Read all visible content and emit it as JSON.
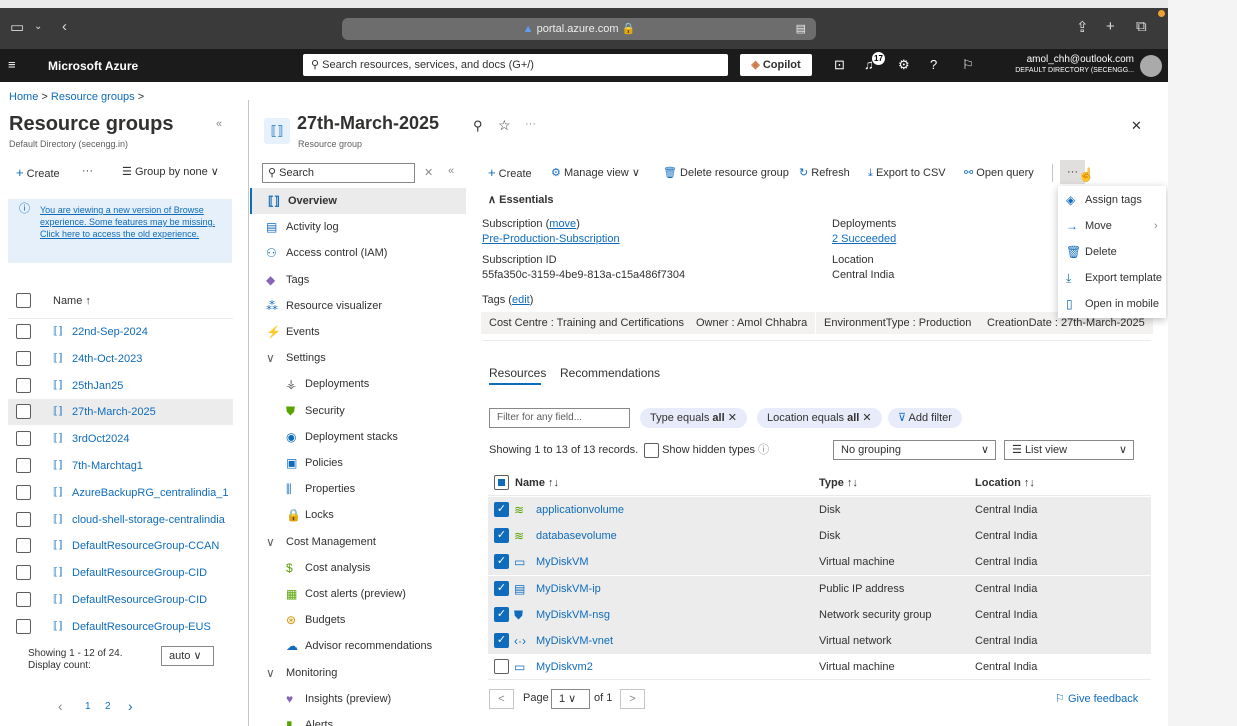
{
  "browser": {
    "url": "portal.azure.com",
    "lock": "🔒"
  },
  "azure": {
    "brand": "Microsoft Azure",
    "search_placeholder": "Search resources, services, and docs (G+/)",
    "copilot": "Copilot",
    "notif_count": "17",
    "user_email": "amol_chh@outlook.com",
    "user_dir": "DEFAULT DIRECTORY (SECENGG..."
  },
  "breadcrumb": {
    "home": "Home",
    "sep1": ">",
    "rg": "Resource groups",
    "sep2": ">"
  },
  "left": {
    "title": "Resource groups",
    "subtitle": "Default Directory (secengg.in)",
    "collapse": "«",
    "create": "Create",
    "more": "···",
    "group_by": "Group by none",
    "banner": "You are viewing a new version of Browse experience. Some features may be missing. Click here to access the old experience.",
    "col_name": "Name ↑",
    "items": [
      "22nd-Sep-2024",
      "24th-Oct-2023",
      "25thJan25",
      "27th-March-2025",
      "3rdOct2024",
      "7th-Marchtag1",
      "AzureBackupRG_centralindia_1",
      "cloud-shell-storage-centralindia",
      "DefaultResourceGroup-CCAN",
      "DefaultResourceGroup-CID",
      "DefaultResourceGroup-CID",
      "DefaultResourceGroup-EUS"
    ],
    "showing": "Showing 1 - 12 of 24.",
    "display_count": "Display count:",
    "count_value": "auto",
    "pages": [
      "1",
      "2"
    ]
  },
  "rg": {
    "title": "27th-March-2025",
    "subtitle": "Resource group",
    "pin": "⚲",
    "star": "☆",
    "more": "···",
    "close": "✕"
  },
  "nav": {
    "search_placeholder": "Search",
    "items": [
      "Overview",
      "Activity log",
      "Access control (IAM)",
      "Tags",
      "Resource visualizer",
      "Events",
      "Settings",
      "Deployments",
      "Security",
      "Deployment stacks",
      "Policies",
      "Properties",
      "Locks",
      "Cost Management",
      "Cost analysis",
      "Cost alerts (preview)",
      "Budgets",
      "Advisor recommendations",
      "Monitoring",
      "Insights (preview)",
      "Alerts"
    ]
  },
  "toolbar": {
    "create": "Create",
    "manage_view": "Manage view",
    "delete": "Delete resource group",
    "refresh": "Refresh",
    "export_csv": "Export to CSV",
    "open_query": "Open query",
    "more": "···"
  },
  "essentials": {
    "header": "Essentials",
    "subscription_label": "Subscription",
    "move_link": "move",
    "subscription_value": "Pre-Production-Subscription",
    "subscription_id_label": "Subscription ID",
    "subscription_id": "55fa350c-3159-4be9-813a-c15a486f7304",
    "deployments_label": "Deployments",
    "deployments_value": "2 Succeeded",
    "location_label": "Location",
    "location_value": "Central India",
    "tags_label": "Tags",
    "edit_link": "edit",
    "tags": [
      "Cost Centre : Training and Certifications",
      "Owner : Amol Chhabra",
      "EnvironmentType : Production",
      "CreationDate : 27th-March-2025"
    ]
  },
  "context_menu": [
    "Assign tags",
    "Move",
    "Delete",
    "Export template",
    "Open in mobile"
  ],
  "resources": {
    "tab_resources": "Resources",
    "tab_recommendations": "Recommendations",
    "filter_placeholder": "Filter for any field...",
    "filter_type": "Type equals",
    "filter_location": "Location equals",
    "all": "all",
    "add_filter": "Add filter",
    "showing": "Showing 1 to 13 of 13 records.",
    "show_hidden": "Show hidden types",
    "grouping": "No grouping",
    "view": "List view",
    "col_name": "Name",
    "col_type": "Type",
    "col_location": "Location",
    "rows": [
      {
        "name": "applicationvolume",
        "type": "Disk",
        "location": "Central India"
      },
      {
        "name": "databasevolume",
        "type": "Disk",
        "location": "Central India"
      },
      {
        "name": "MyDiskVM",
        "type": "Virtual machine",
        "location": "Central India"
      },
      {
        "name": "MyDiskVM-ip",
        "type": "Public IP address",
        "location": "Central India"
      },
      {
        "name": "MyDiskVM-nsg",
        "type": "Network security group",
        "location": "Central India"
      },
      {
        "name": "MyDiskVM-vnet",
        "type": "Virtual network",
        "location": "Central India"
      },
      {
        "name": "MyDiskvm2",
        "type": "Virtual machine",
        "location": "Central India"
      }
    ],
    "page_label": "Page",
    "page_value": "1",
    "page_of": "of 1",
    "prev": "<",
    "next": ">",
    "feedback": "Give feedback"
  },
  "colors": {
    "accent": "#0f6cbd",
    "chrome": "#3a3a3a",
    "azure_bar": "#1b1b1b"
  }
}
